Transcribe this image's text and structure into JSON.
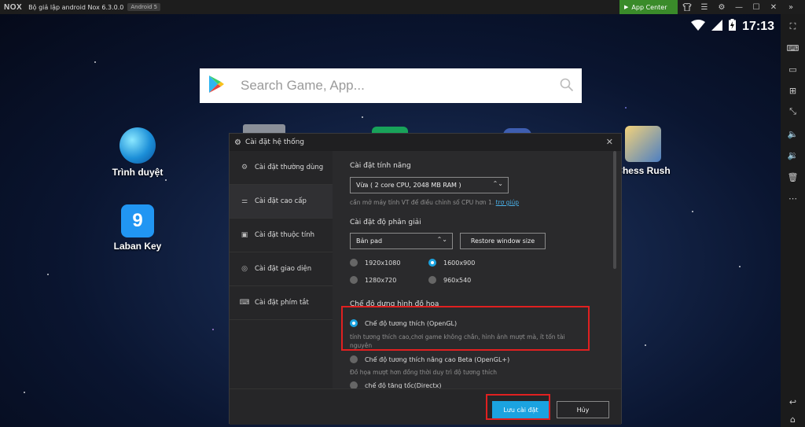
{
  "titlebar": {
    "logo": "NOX",
    "title": "Bộ giả lập android Nox 6.3.0.0",
    "android_badge": "Android 5",
    "app_center": "App Center",
    "icons": [
      "shirt-icon",
      "menu-icon",
      "gear-icon",
      "minimize-icon",
      "maximize-icon",
      "close-icon"
    ]
  },
  "sidebar": {
    "icons": [
      "full-screen-icon",
      "keyboard-icon",
      "screenshot-icon",
      "add-apk-icon",
      "resize-icon",
      "volume-up-icon",
      "volume-down-icon",
      "trash-icon",
      "more-icon",
      "back-icon",
      "home-icon"
    ]
  },
  "statusbar": {
    "time": "17:13"
  },
  "search": {
    "placeholder": "Search Game, App..."
  },
  "apps": {
    "browser": "Trình duyệt",
    "laban": "Laban Key",
    "chess": "Chess Rush"
  },
  "dialog": {
    "title": "Cài đặt hệ thống",
    "nav": [
      {
        "label": "Cài đặt thường dùng",
        "icon": "gear-icon"
      },
      {
        "label": "Cài đặt cao cấp",
        "icon": "sliders-icon"
      },
      {
        "label": "Cài đặt thuộc tính",
        "icon": "properties-icon"
      },
      {
        "label": "Cài đặt giao diện",
        "icon": "palette-icon"
      },
      {
        "label": "Cài đặt phím tắt",
        "icon": "keyboard-icon"
      }
    ],
    "performance": {
      "title": "Cài đặt tính năng",
      "selected": "Vừa ( 2 core CPU, 2048 MB RAM )",
      "hint": "cần mở máy tính VT để điều chỉnh số CPU hơn 1.",
      "help_link": "trợ giúp"
    },
    "resolution": {
      "title": "Cài đặt độ phân giải",
      "selected": "Bản pad",
      "restore_button": "Restore window size",
      "options": [
        "1920x1080",
        "1600x900",
        "1280x720",
        "960x540"
      ],
      "selected_option": "1600x900"
    },
    "graphics": {
      "title": "Chế độ dựng hình đồ họa",
      "opengl_label": "Chế độ tương thích (OpenGL)",
      "opengl_desc": "tính tương thích cao,chơi game không chắn, hình ảnh mượt mà, ít tốn tài nguyên",
      "openglplus_label": "Chế độ tương thích nâng cao Beta (OpenGL+)",
      "openglplus_desc": "Đồ họa mượt hơn đồng thời duy trì độ tương thích",
      "directx_label": "chế độ tăng tốc(Directx)",
      "selected": "Chế độ tương thích (OpenGL)"
    },
    "save_button": "Lưu cài đặt",
    "cancel_button": "Hủy"
  },
  "colors": {
    "accent": "#1ba3e0",
    "highlight": "#e02020",
    "app_center": "#3a8b2a"
  }
}
